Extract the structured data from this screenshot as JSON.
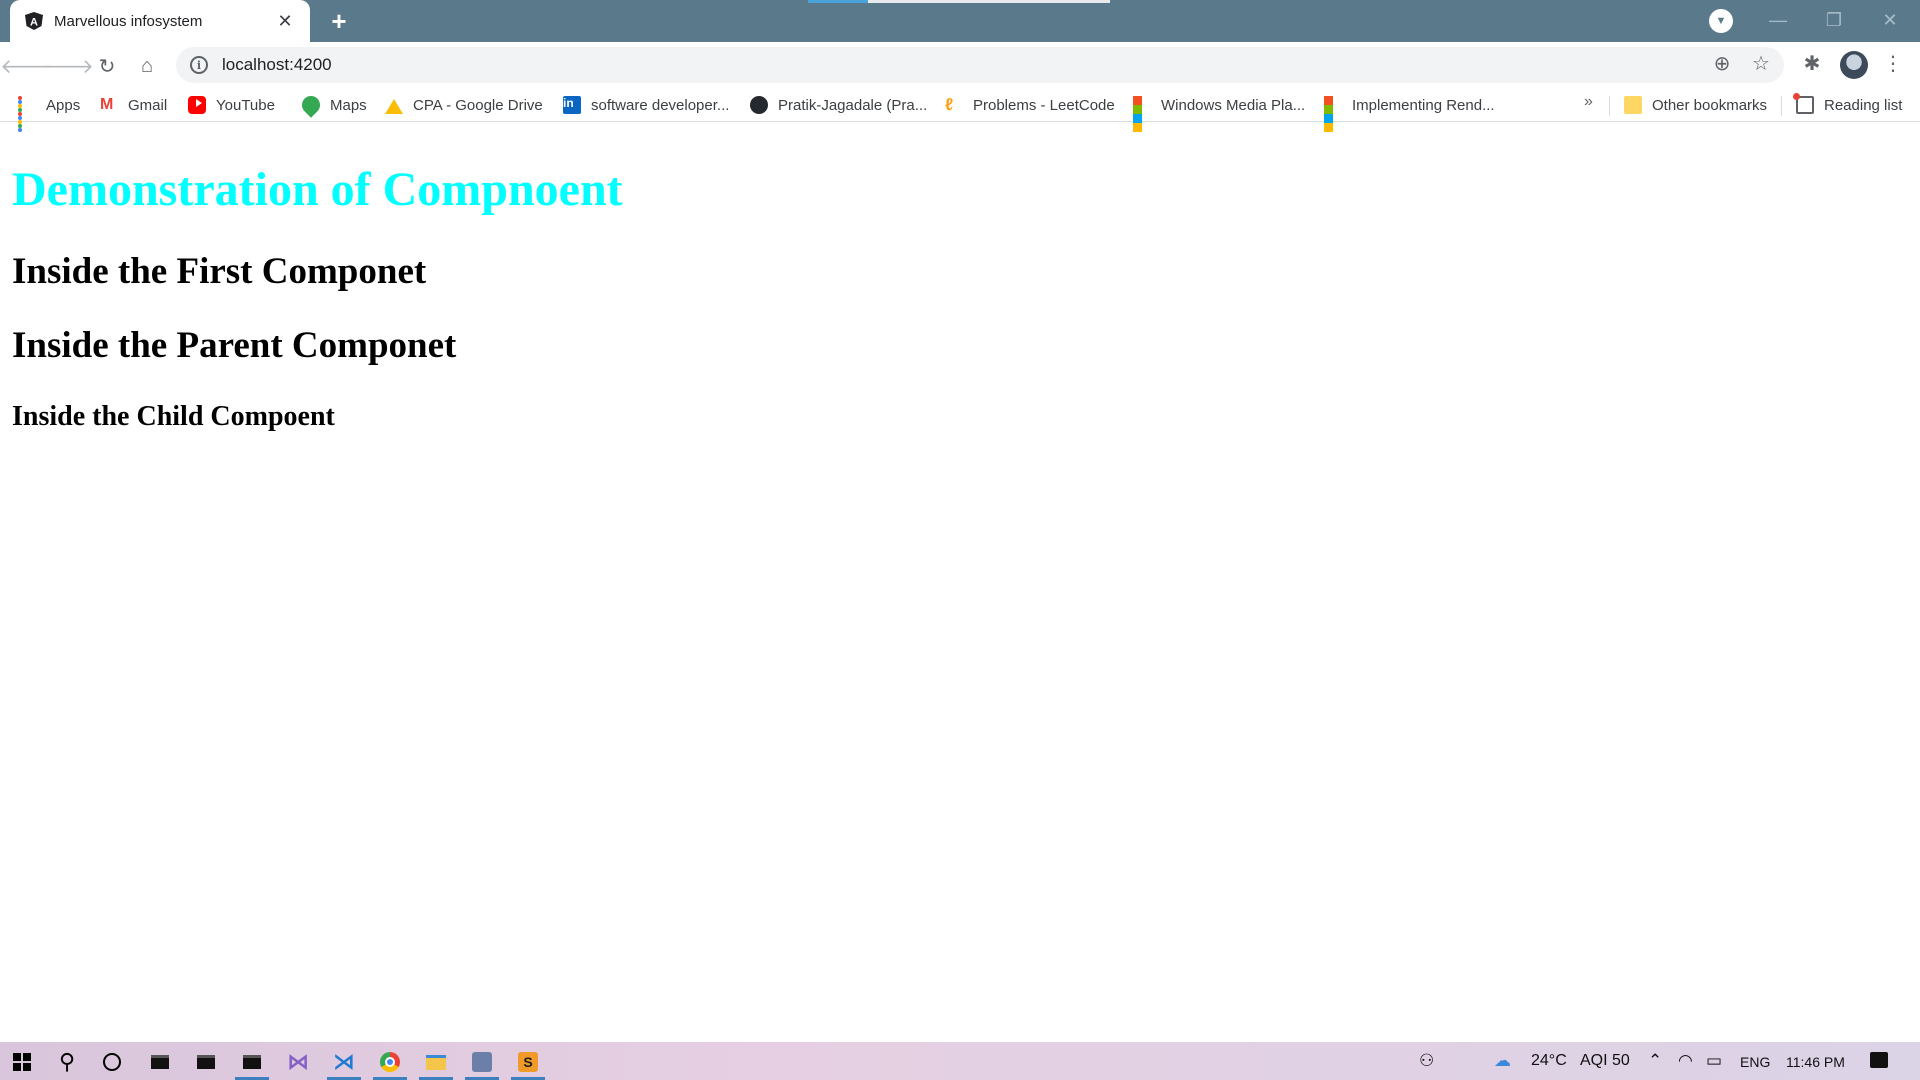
{
  "browser": {
    "tab": {
      "title": "Marvellous infosystem",
      "favicon": "angular-icon"
    },
    "page_load_progress": 0.2,
    "url": "localhost:4200",
    "bookmarks": [
      {
        "label": "Apps",
        "icon": "apps-grid-icon"
      },
      {
        "label": "Gmail",
        "icon": "gmail-icon"
      },
      {
        "label": "YouTube",
        "icon": "youtube-icon"
      },
      {
        "label": "Maps",
        "icon": "maps-icon"
      },
      {
        "label": "CPA - Google Drive",
        "icon": "google-drive-icon"
      },
      {
        "label": "software developer...",
        "icon": "linkedin-icon"
      },
      {
        "label": "Pratik-Jagadale (Pra...",
        "icon": "github-icon"
      },
      {
        "label": "Problems - LeetCode",
        "icon": "leetcode-icon"
      },
      {
        "label": "Windows Media Pla...",
        "icon": "microsoft-icon"
      },
      {
        "label": "Implementing Rend...",
        "icon": "microsoft-icon"
      }
    ],
    "overflow_label": "»",
    "other_bookmarks": "Other bookmarks",
    "reading_list": "Reading list"
  },
  "page": {
    "heading": "Demonstration of Compnoent",
    "first_component": "Inside the First Componet",
    "parent_component": "Inside the Parent Componet",
    "child_component": "Inside the Child Compoent"
  },
  "taskbar": {
    "weather": "24°C",
    "aqi": "AQI 50",
    "language": "ENG",
    "time": "11:46 PM"
  },
  "colors": {
    "heading": "#00ffff",
    "tabstrip": "#5a7a8c"
  }
}
